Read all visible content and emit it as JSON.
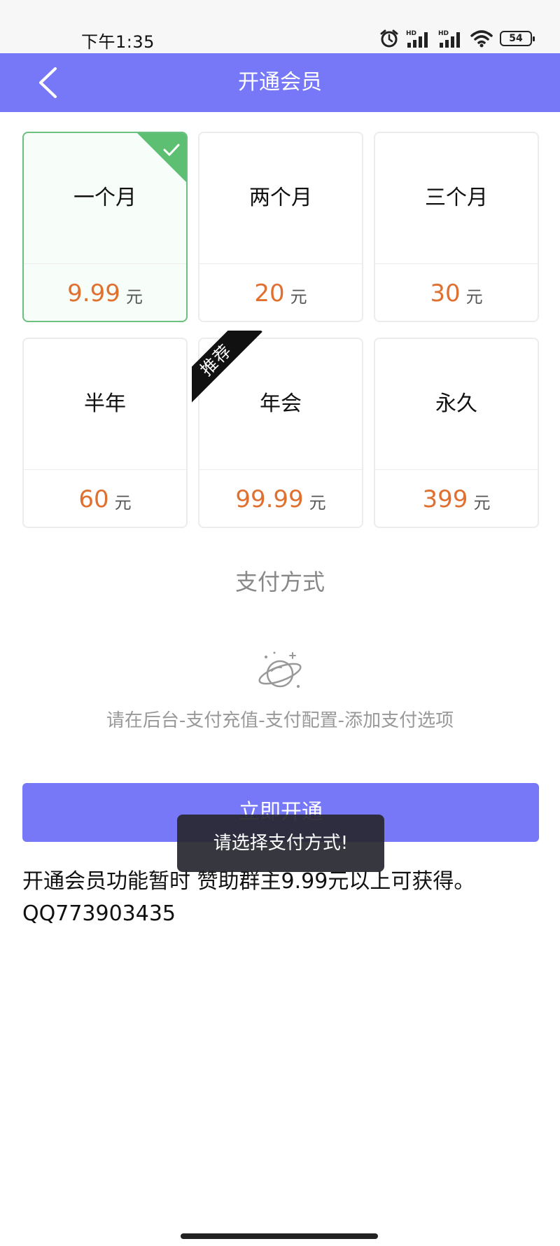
{
  "status_bar": {
    "time": "下午1:35",
    "battery": "54",
    "icons": [
      "alarm-icon",
      "signal-hd-icon",
      "signal-hd-icon",
      "wifi-icon",
      "battery-icon"
    ]
  },
  "header": {
    "title": "开通会员",
    "back_icon": "chevron-left-icon"
  },
  "plans": [
    {
      "name": "一个月",
      "price": "9.99",
      "currency": "元",
      "selected": true
    },
    {
      "name": "两个月",
      "price": "20",
      "currency": "元"
    },
    {
      "name": "三个月",
      "price": "30",
      "currency": "元"
    },
    {
      "name": "半年",
      "price": "60",
      "currency": "元"
    },
    {
      "name": "年会",
      "price": "99.99",
      "currency": "元",
      "badge": "推荐"
    },
    {
      "name": "永久",
      "price": "399",
      "currency": "元"
    }
  ],
  "payment": {
    "title": "支付方式",
    "hint": "请在后台-支付充值-支付配置-添加支付选项"
  },
  "activate_label": "立即开通",
  "toast": "请选择支付方式!",
  "notice": {
    "line1": "开通会员功能暂时 赞助群主9.99元以上可获得。",
    "line2": "QQ773903435"
  },
  "colors": {
    "primary": "#7778f7",
    "price": "#e0702f",
    "selected_border": "#6bbf7f",
    "selected_check": "#5cbf72"
  }
}
